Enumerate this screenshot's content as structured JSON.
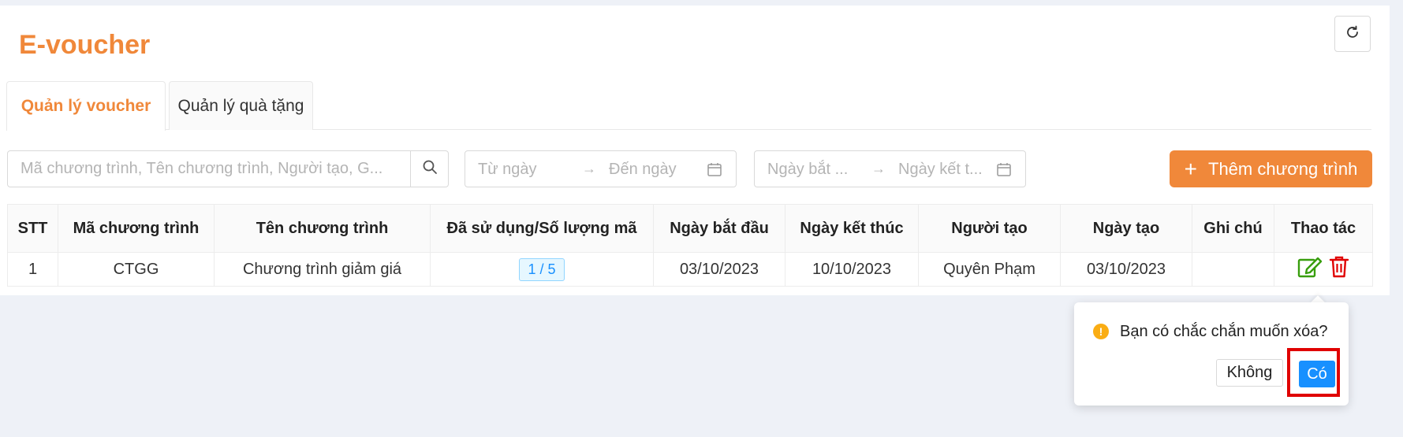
{
  "header": {
    "title": "E-voucher"
  },
  "tabs": [
    {
      "label": "Quản lý voucher",
      "active": true
    },
    {
      "label": "Quản lý quà tặng",
      "active": false
    }
  ],
  "filters": {
    "search_placeholder": "Mã chương trình, Tên chương trình, Người tạo, G...",
    "range1": {
      "start_placeholder": "Từ ngày",
      "end_placeholder": "Đến ngày"
    },
    "range2": {
      "start_placeholder": "Ngày bắt ...",
      "end_placeholder": "Ngày kết t..."
    }
  },
  "add_button": {
    "label": "Thêm chương trình"
  },
  "table": {
    "columns": [
      "STT",
      "Mã chương trình",
      "Tên chương trình",
      "Đã sử dụng/Số lượng mã",
      "Ngày bắt đầu",
      "Ngày kết thúc",
      "Người tạo",
      "Ngày tạo",
      "Ghi chú",
      "Thao tác"
    ],
    "rows": [
      {
        "stt": "1",
        "code": "CTGG",
        "name": "Chương trình giảm giá",
        "usage": "1 / 5",
        "start": "03/10/2023",
        "end": "10/10/2023",
        "creator": "Quyên Phạm",
        "created": "03/10/2023",
        "note": ""
      }
    ]
  },
  "popconfirm": {
    "message": "Bạn có chắc chắn muốn xóa?",
    "cancel_label": "Không",
    "ok_label": "Có"
  },
  "colors": {
    "accent": "#f0883a",
    "primary": "#1890ff",
    "edit": "#389e0d",
    "delete": "#e00000",
    "warning": "#faad14"
  }
}
